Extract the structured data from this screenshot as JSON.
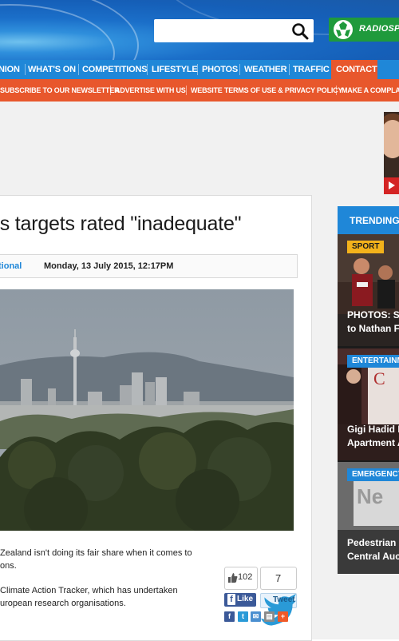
{
  "search": {
    "placeholder": ""
  },
  "brand": {
    "logo_text": "RADIOSPORT"
  },
  "nav": {
    "items": [
      "NION",
      "WHAT'S ON",
      "COMPETITIONS",
      "LIFESTYLE",
      "PHOTOS",
      "WEATHER",
      "TRAFFIC",
      "CONTACT"
    ]
  },
  "subnav": {
    "items": [
      "SUBSCRIBE TO OUR NEWSLETTER",
      "ADVERTISE WITH US",
      "WEBSITE TERMS OF USE & PRIVACY POLICY",
      "MAKE A COMPLAINT"
    ]
  },
  "article": {
    "headline": "ns targets rated \"inadequate\"",
    "category": "tional",
    "date": "Monday, 13 July 2015, 12:17PM",
    "paragraphs": [
      [
        "Zealand isn't doing its fair share when it comes to",
        "ons."
      ],
      [
        "Climate Action Tracker, which has undertaken",
        "uropean research organisations."
      ]
    ]
  },
  "share": {
    "likes": "102",
    "tweets": "7",
    "like_label": "Like",
    "tweet_label": "Tweet",
    "icons": [
      "facebook-icon",
      "twitter-icon",
      "email-icon",
      "print-icon",
      "plus-icon"
    ]
  },
  "sidebar": {
    "title": "TRENDING S",
    "cards": [
      {
        "tag": "SPORT",
        "title_lines": [
          "PHOTOS: So",
          "to Nathan Fr"
        ]
      },
      {
        "tag": "ENTERTAINM",
        "title_lines": [
          "Gigi Hadid L",
          "Apartment A"
        ]
      },
      {
        "tag": "EMERGENCY",
        "title_lines": [
          "Pedestrian k",
          "Central Auck"
        ]
      }
    ]
  },
  "colors": {
    "nav_blue": "#1f87d8",
    "accent_orange": "#e8572c",
    "sport_tag": "#f3b21b",
    "brand_green": "#1f9a3c"
  }
}
